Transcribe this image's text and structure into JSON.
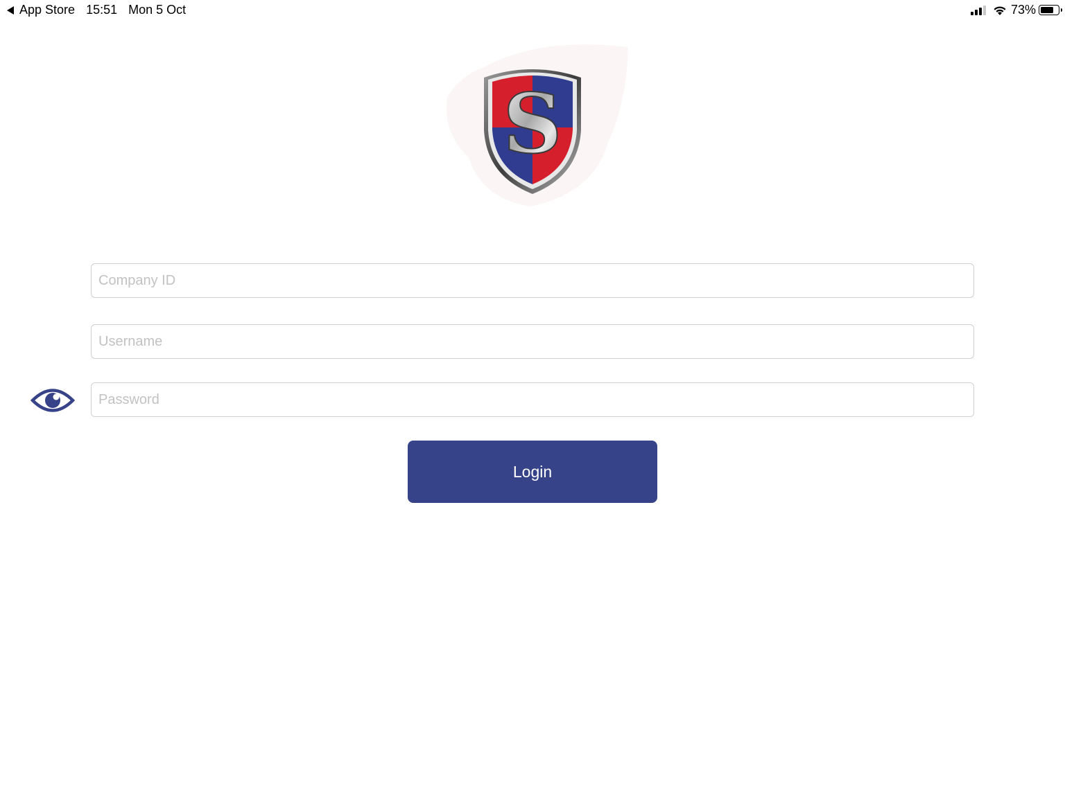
{
  "status_bar": {
    "back_label": "App Store",
    "time": "15:51",
    "date": "Mon 5 Oct",
    "battery_percent": "73%",
    "battery_level": 0.73,
    "signal_icon": "cellular-signal-icon",
    "wifi_icon": "wifi-icon"
  },
  "logo": {
    "letter": "S",
    "colors": {
      "red": "#d61f2c",
      "blue": "#2f3c8f",
      "rim": "#5a5a5a"
    }
  },
  "form": {
    "company_id_placeholder": "Company ID",
    "company_id_value": "",
    "username_placeholder": "Username",
    "username_value": "",
    "password_placeholder": "Password",
    "password_value": "",
    "show_password_icon": "eye-icon",
    "login_label": "Login"
  },
  "colors": {
    "accent": "#374389",
    "field_border": "#cfcfcf",
    "placeholder": "#c2c2c2"
  }
}
